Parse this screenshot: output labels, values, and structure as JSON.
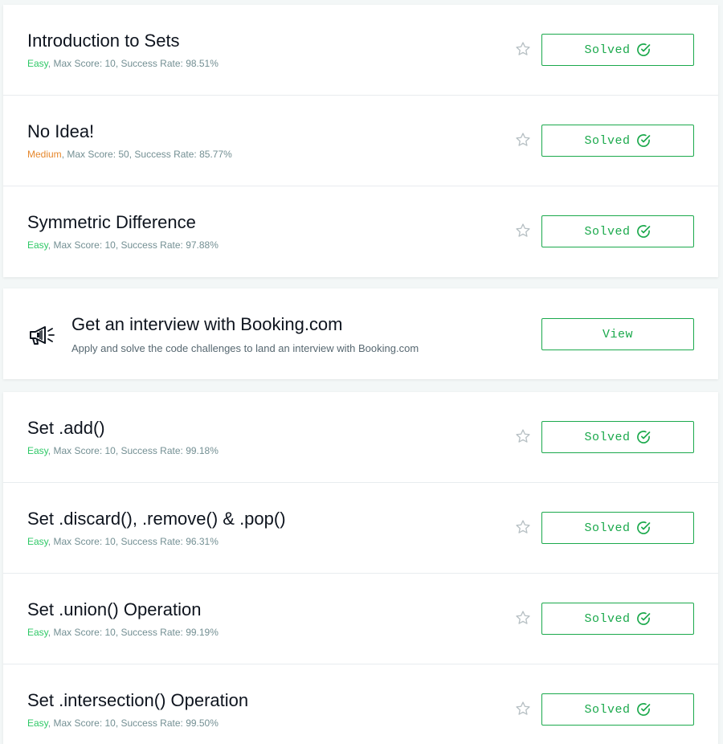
{
  "colors": {
    "accent": "#1ba94c",
    "easy": "#2ec866",
    "medium": "#e6872c",
    "muted": "#738f93"
  },
  "group1": [
    {
      "title": "Introduction to Sets",
      "difficulty": "Easy",
      "rest": ", Max Score: 10, Success Rate: 98.51%",
      "status": "Solved",
      "star_icon": "star-outline-icon",
      "status_icon": "check-circle-icon"
    },
    {
      "title": "No Idea!",
      "difficulty": "Medium",
      "rest": ", Max Score: 50, Success Rate: 85.77%",
      "status": "Solved",
      "star_icon": "star-outline-icon",
      "status_icon": "check-circle-icon"
    },
    {
      "title": "Symmetric Difference",
      "difficulty": "Easy",
      "rest": ", Max Score: 10, Success Rate: 97.88%",
      "status": "Solved",
      "star_icon": "star-outline-icon",
      "status_icon": "check-circle-icon"
    }
  ],
  "promo": {
    "icon": "megaphone-icon",
    "title": "Get an interview with Booking.com",
    "subtitle": "Apply and solve the code challenges to land an interview with Booking.com",
    "button": "View"
  },
  "group2": [
    {
      "title": "Set .add()",
      "difficulty": "Easy",
      "rest": ", Max Score: 10, Success Rate: 99.18%",
      "status": "Solved",
      "star_icon": "star-outline-icon",
      "status_icon": "check-circle-icon"
    },
    {
      "title": "Set .discard(), .remove() & .pop()",
      "difficulty": "Easy",
      "rest": ", Max Score: 10, Success Rate: 96.31%",
      "status": "Solved",
      "star_icon": "star-outline-icon",
      "status_icon": "check-circle-icon"
    },
    {
      "title": "Set .union() Operation",
      "difficulty": "Easy",
      "rest": ", Max Score: 10, Success Rate: 99.19%",
      "status": "Solved",
      "star_icon": "star-outline-icon",
      "status_icon": "check-circle-icon"
    },
    {
      "title": "Set .intersection() Operation",
      "difficulty": "Easy",
      "rest": ", Max Score: 10, Success Rate: 99.50%",
      "status": "Solved",
      "star_icon": "star-outline-icon",
      "status_icon": "check-circle-icon"
    }
  ]
}
